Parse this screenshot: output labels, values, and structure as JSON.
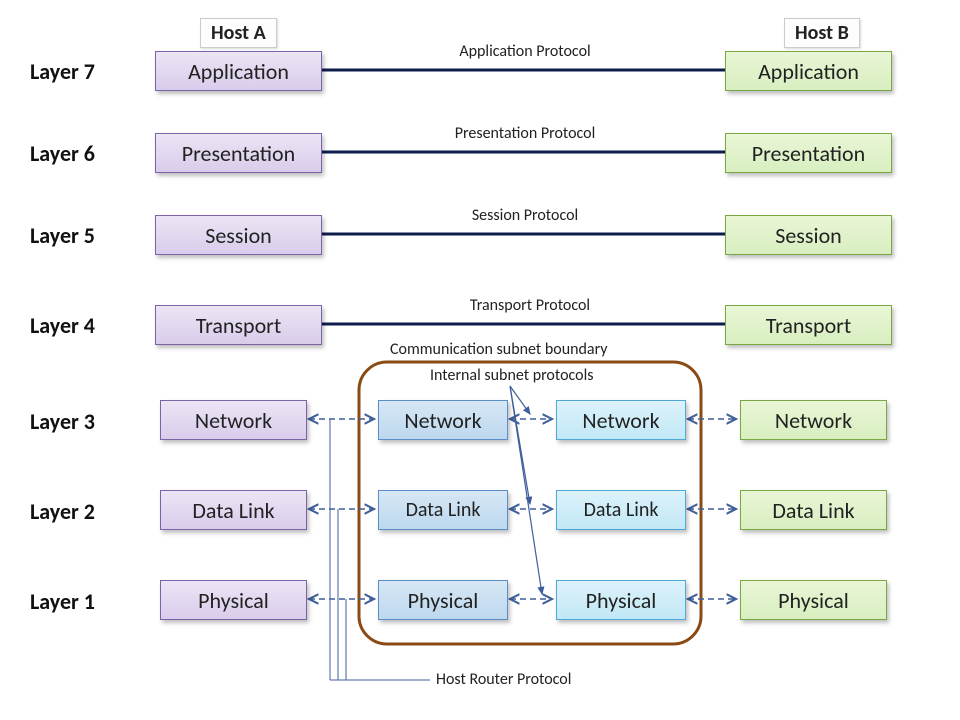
{
  "hosts": {
    "a": "Host A",
    "b": "Host B"
  },
  "layerLabels": {
    "l7": "Layer 7",
    "l6": "Layer 6",
    "l5": "Layer 5",
    "l4": "Layer 4",
    "l3": "Layer 3",
    "l2": "Layer 2",
    "l1": "Layer 1"
  },
  "boxes": {
    "a_app": "Application",
    "b_app": "Application",
    "a_pres": "Presentation",
    "b_pres": "Presentation",
    "a_sess": "Session",
    "b_sess": "Session",
    "a_tran": "Transport",
    "b_tran": "Transport",
    "a_net": "Network",
    "r1_net": "Network",
    "r2_net": "Network",
    "b_net": "Network",
    "a_dl": "Data Link",
    "r1_dl": "Data Link",
    "r2_dl": "Data Link",
    "b_dl": "Data Link",
    "a_phy": "Physical",
    "r1_phy": "Physical",
    "r2_phy": "Physical",
    "b_phy": "Physical"
  },
  "protocols": {
    "app": "Application Protocol",
    "pres": "Presentation Protocol",
    "sess": "Session  Protocol",
    "tran": "Transport  Protocol"
  },
  "annotations": {
    "subnet_boundary": "Communication subnet boundary",
    "internal_protocols": "Internal subnet protocols",
    "host_router": "Host Router Protocol"
  }
}
